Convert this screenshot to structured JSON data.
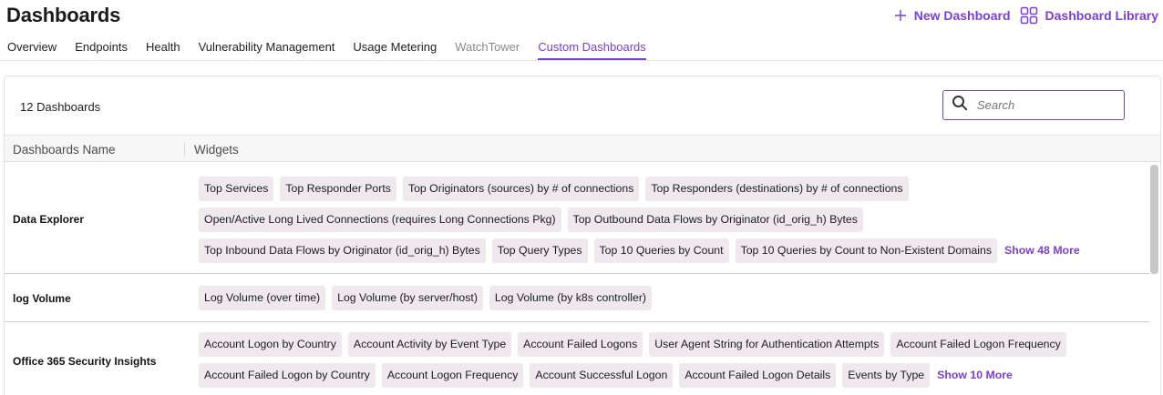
{
  "header": {
    "title": "Dashboards",
    "new_dashboard": {
      "label": "New Dashboard",
      "icon": "plus-icon"
    },
    "dashboard_library": {
      "label": "Dashboard Library",
      "icon": "grid-icon"
    }
  },
  "tabs": [
    {
      "label": "Overview",
      "state": "normal"
    },
    {
      "label": "Endpoints",
      "state": "normal"
    },
    {
      "label": "Health",
      "state": "normal"
    },
    {
      "label": "Vulnerability Management",
      "state": "normal"
    },
    {
      "label": "Usage Metering",
      "state": "normal"
    },
    {
      "label": "WatchTower",
      "state": "disabled"
    },
    {
      "label": "Custom Dashboards",
      "state": "active"
    }
  ],
  "toolbar": {
    "count": "12 Dashboards",
    "search_placeholder": "Search"
  },
  "table": {
    "columns": [
      "Dashboards Name",
      "Widgets"
    ],
    "rows": [
      {
        "name": "Data Explorer",
        "widgets": [
          "Top Services",
          "Top Responder Ports",
          "Top Originators (sources) by # of connections",
          "Top Responders (destinations) by # of connections",
          "Open/Active Long Lived Connections (requires Long Connections Pkg)",
          "Top Outbound Data Flows by Originator (id_orig_h) Bytes",
          "Top Inbound Data Flows by Originator (id_orig_h) Bytes",
          "Top Query Types",
          "Top 10 Queries by Count",
          "Top 10 Queries by Count to Non-Existent Domains"
        ],
        "more": "Show 48 More"
      },
      {
        "name": "log Volume",
        "widgets": [
          "Log Volume (over time)",
          "Log Volume (by server/host)",
          "Log Volume (by k8s controller)"
        ],
        "more": ""
      },
      {
        "name": "Office 365 Security Insights",
        "widgets": [
          "Account Logon by Country",
          "Account Activity by Event Type",
          "Account Failed Logons",
          "User Agent String for Authentication Attempts",
          "Account Failed Logon Frequency",
          "Account Failed Logon by Country",
          "Account Logon Frequency",
          "Account Successful Logon",
          "Account Failed Logon Details",
          "Events by Type"
        ],
        "more": "Show 10 More"
      }
    ]
  },
  "colors": {
    "accent": "#7c3fd1",
    "chip_bg": "#efe9ee"
  }
}
